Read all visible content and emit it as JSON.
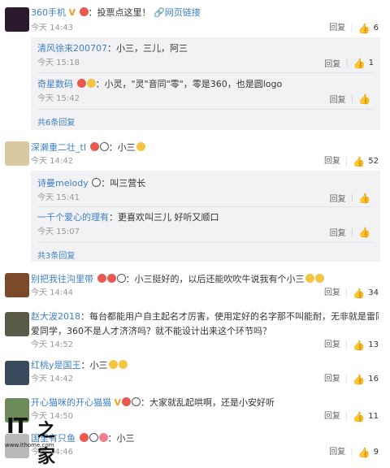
{
  "actions": {
    "reply": "回复",
    "thumb": "👍"
  },
  "comments": [
    {
      "name": "360手机",
      "text": "投票点这里！",
      "link": "网页链接",
      "time": "今天 14:43",
      "likes": "6",
      "replies": [
        {
          "name": "清风徐来200707",
          "text": "小三，三儿，阿三",
          "time": "今天 15:18",
          "likes": "1"
        },
        {
          "name": "奇星数码",
          "text": "小灵，\"灵\"音同\"零\"，零是360，也是圆logo",
          "time": "今天 15:42",
          "likes": ""
        }
      ],
      "more": "共6条回复"
    },
    {
      "name": "深濑重二壮_tI",
      "text": "小三",
      "time": "今天 14:42",
      "likes": "52",
      "replies": [
        {
          "name": "诗曼melody",
          "text": "叫三营长",
          "time": "今天 15:41",
          "likes": ""
        },
        {
          "name": "一千个爱心的理有",
          "text": "更喜欢叫三儿 好听又顺口",
          "time": "今天 15:07",
          "likes": ""
        }
      ],
      "more": "共3条回复"
    },
    {
      "name": "别把我往沟里带",
      "text": "小三挺好的，以后还能吹吹牛说我有个小三",
      "time": "今天 14:44",
      "likes": "34"
    },
    {
      "name": "赵大波2018",
      "text": "每台都能用户自主起名才厉害，使用定好的名字那不叫能耐，无非就是雷同小度个小",
      "text2": "爱同学，360不是人才济济吗？就不能设计出来这个环节吗？",
      "time": "今天 14:52",
      "likes": "13"
    },
    {
      "name": "红桃y是国王",
      "text": "小三",
      "time": "今天 14:42",
      "likes": "16"
    },
    {
      "name": "开心猫咪的开心猫猫",
      "text": "大家就乱起哄啊，还是小安好听",
      "time": "今天 14:50",
      "likes": "11"
    },
    {
      "name": "国里有只鱼",
      "text": "小三",
      "time": "今天 14:46",
      "likes": "9"
    }
  ],
  "watermark": {
    "brand": "IT",
    "zh": "之家",
    "url": "www.ithome.com"
  },
  "colors": {
    "link": "#3d7fc4",
    "reply_bg": "#f2f2f5",
    "vip": "#f0a020"
  }
}
